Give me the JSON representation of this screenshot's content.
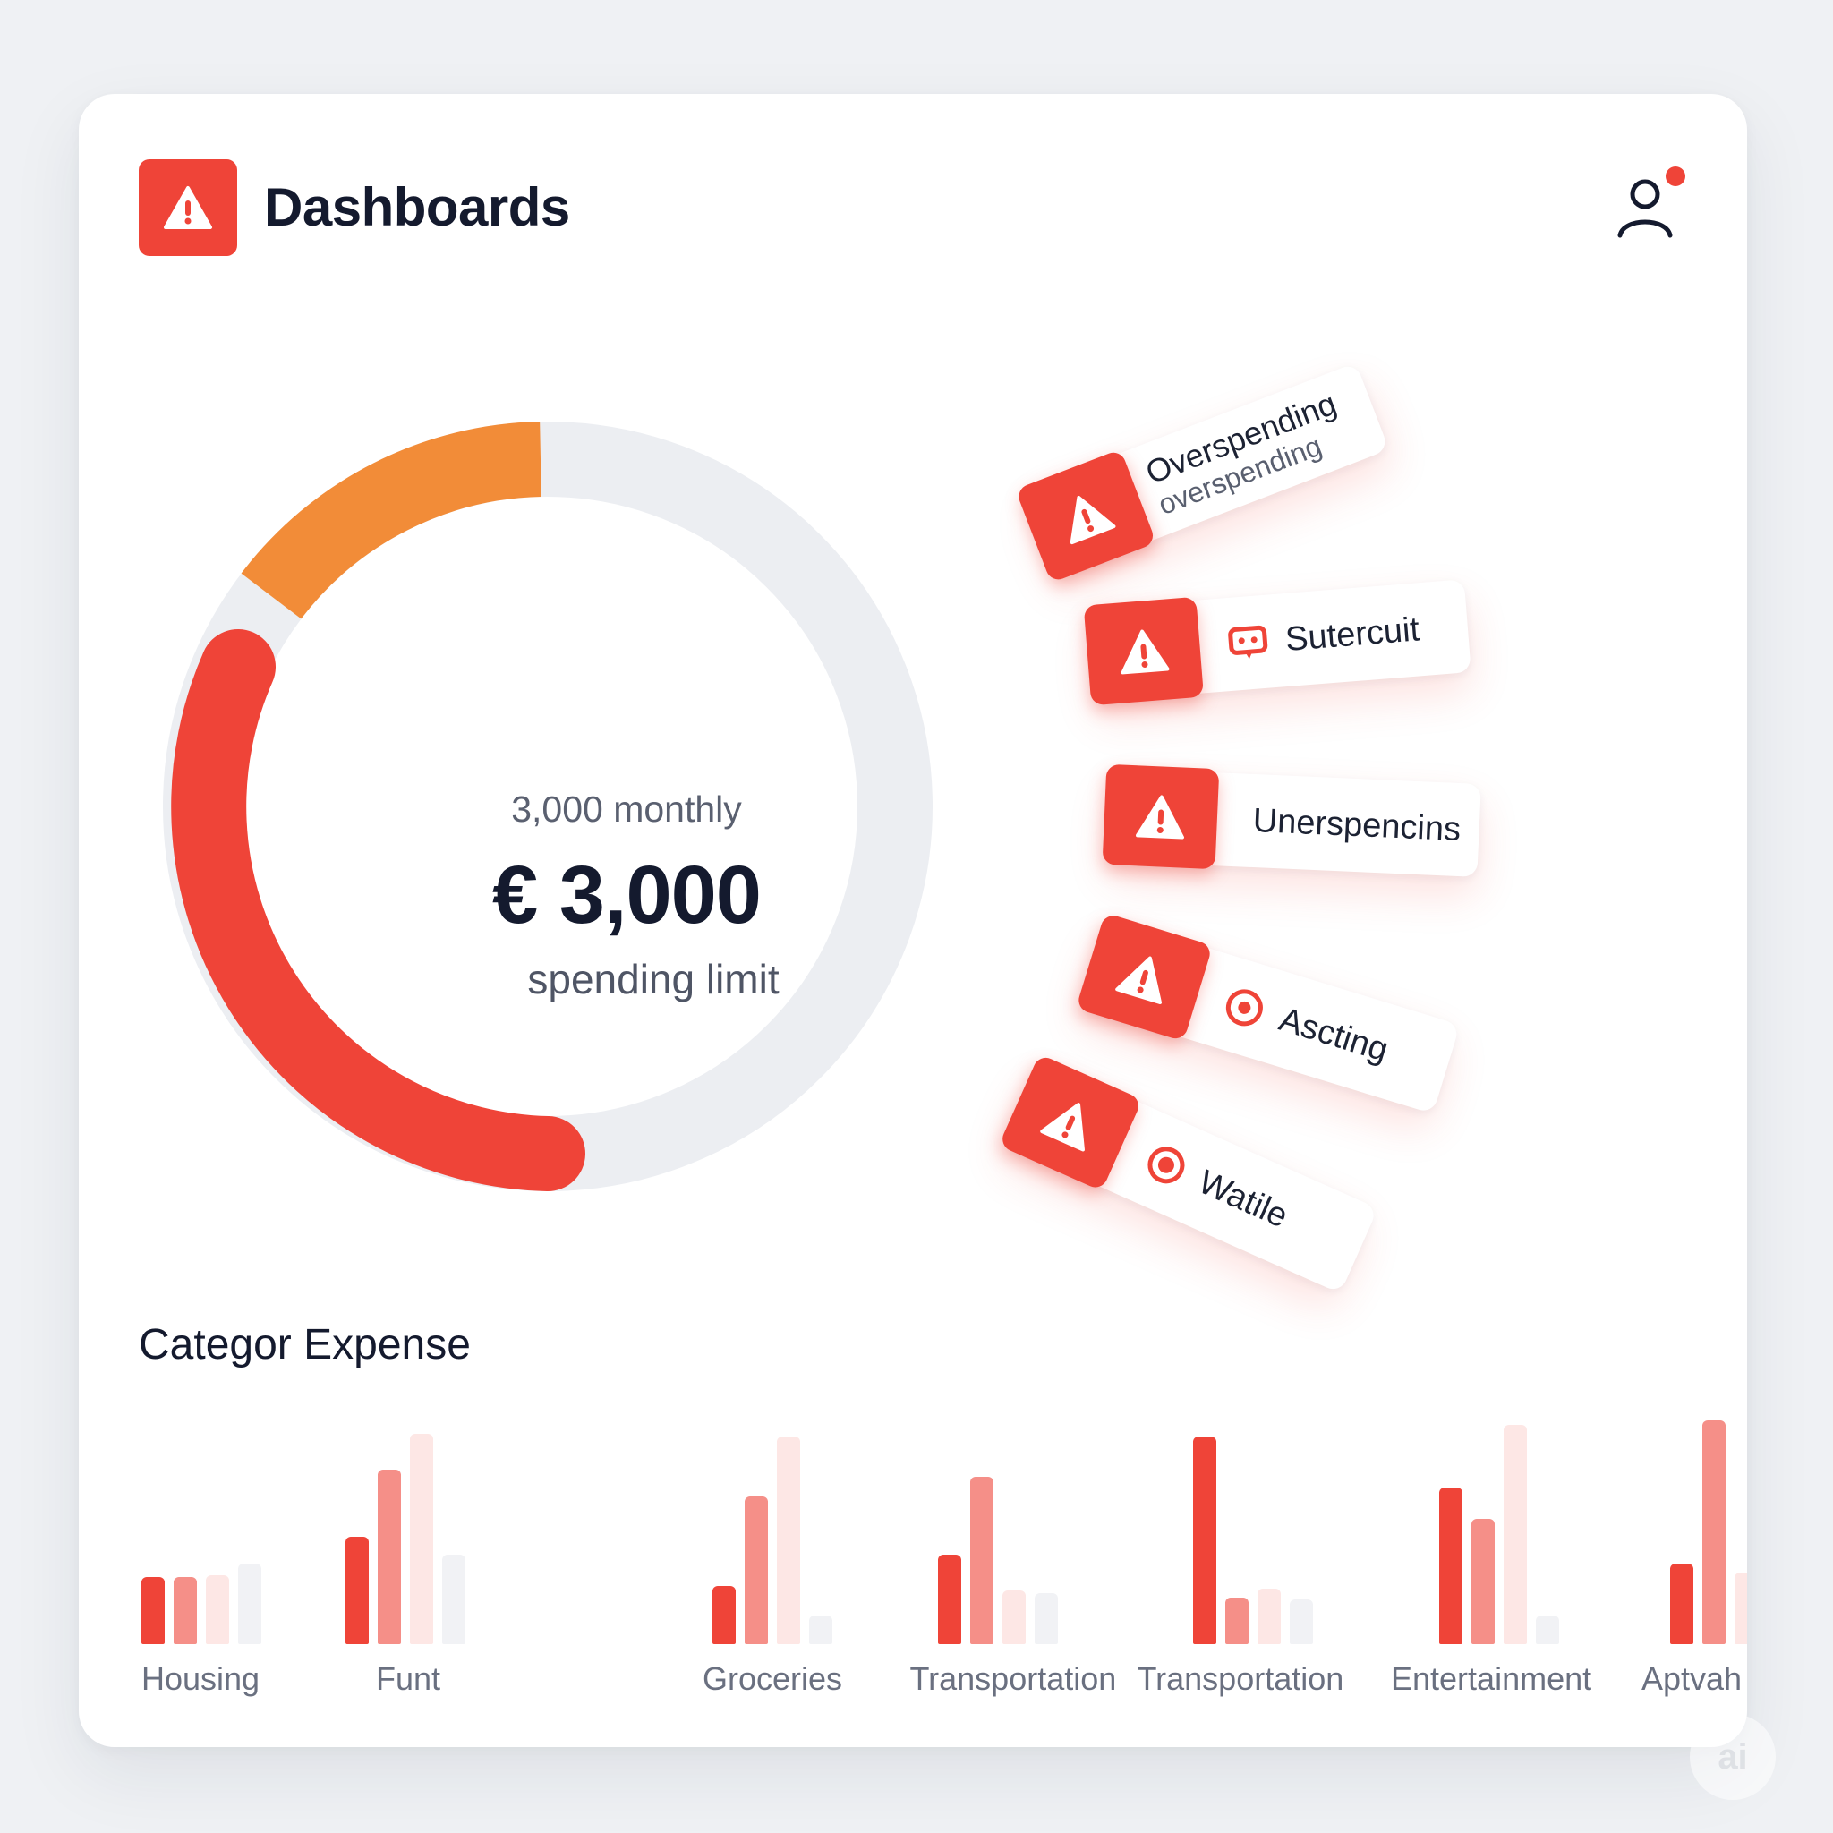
{
  "header": {
    "title": "Dashboards",
    "logo_icon": "warning-icon",
    "user_icon": "user-icon",
    "accent": "#ef4438"
  },
  "budget": {
    "monthly_label": "3,000 monthly",
    "amount": "€ 3,000",
    "caption": "spending limit",
    "segments": [
      {
        "color": "#f28c38",
        "fraction": 0.18
      },
      {
        "color": "#ef4438",
        "fraction": 0.43
      },
      {
        "color": "#eceef2",
        "fraction": 0.39
      }
    ]
  },
  "alerts": [
    {
      "label": "Overspending",
      "sublabel": "overspending",
      "icon": "warning-icon"
    },
    {
      "label": "Sutercuit",
      "icon": "warning-icon",
      "secondary_icon": "chat-bubble-icon"
    },
    {
      "label": "Unerspencins",
      "icon": "warning-icon"
    },
    {
      "label": "Ascting",
      "icon": "warning-icon",
      "secondary_icon": "target-icon"
    },
    {
      "label": "Watile",
      "icon": "warning-icon",
      "secondary_icon": "record-icon"
    }
  ],
  "category_section": {
    "title": "Categor Expense"
  },
  "chart_data": {
    "type": "bar",
    "title": "Categor Expense",
    "categories": [
      "Housing",
      "Funt",
      "Groceries",
      "Transportation",
      "Transportation",
      "Entertainment",
      "Aptvah"
    ],
    "series_colors": [
      "#ef4438",
      "#f58f88",
      "#fde7e5",
      "#f1f2f5"
    ],
    "groups": [
      {
        "category": "Housing",
        "values": [
          30,
          30,
          31,
          36
        ]
      },
      {
        "category": "Funt",
        "values": [
          48,
          78,
          94,
          40
        ]
      },
      {
        "category": "Groceries",
        "values": [
          26,
          66,
          93,
          13
        ]
      },
      {
        "category": "Transportation",
        "values": [
          40,
          75,
          24,
          23
        ]
      },
      {
        "category": "Transportation",
        "values": [
          93,
          21,
          25,
          20
        ]
      },
      {
        "category": "Entertainment",
        "values": [
          70,
          56,
          98,
          13
        ]
      },
      {
        "category": "Aptvah",
        "values": [
          36,
          100,
          32
        ]
      }
    ],
    "ylim": [
      0,
      100
    ]
  }
}
